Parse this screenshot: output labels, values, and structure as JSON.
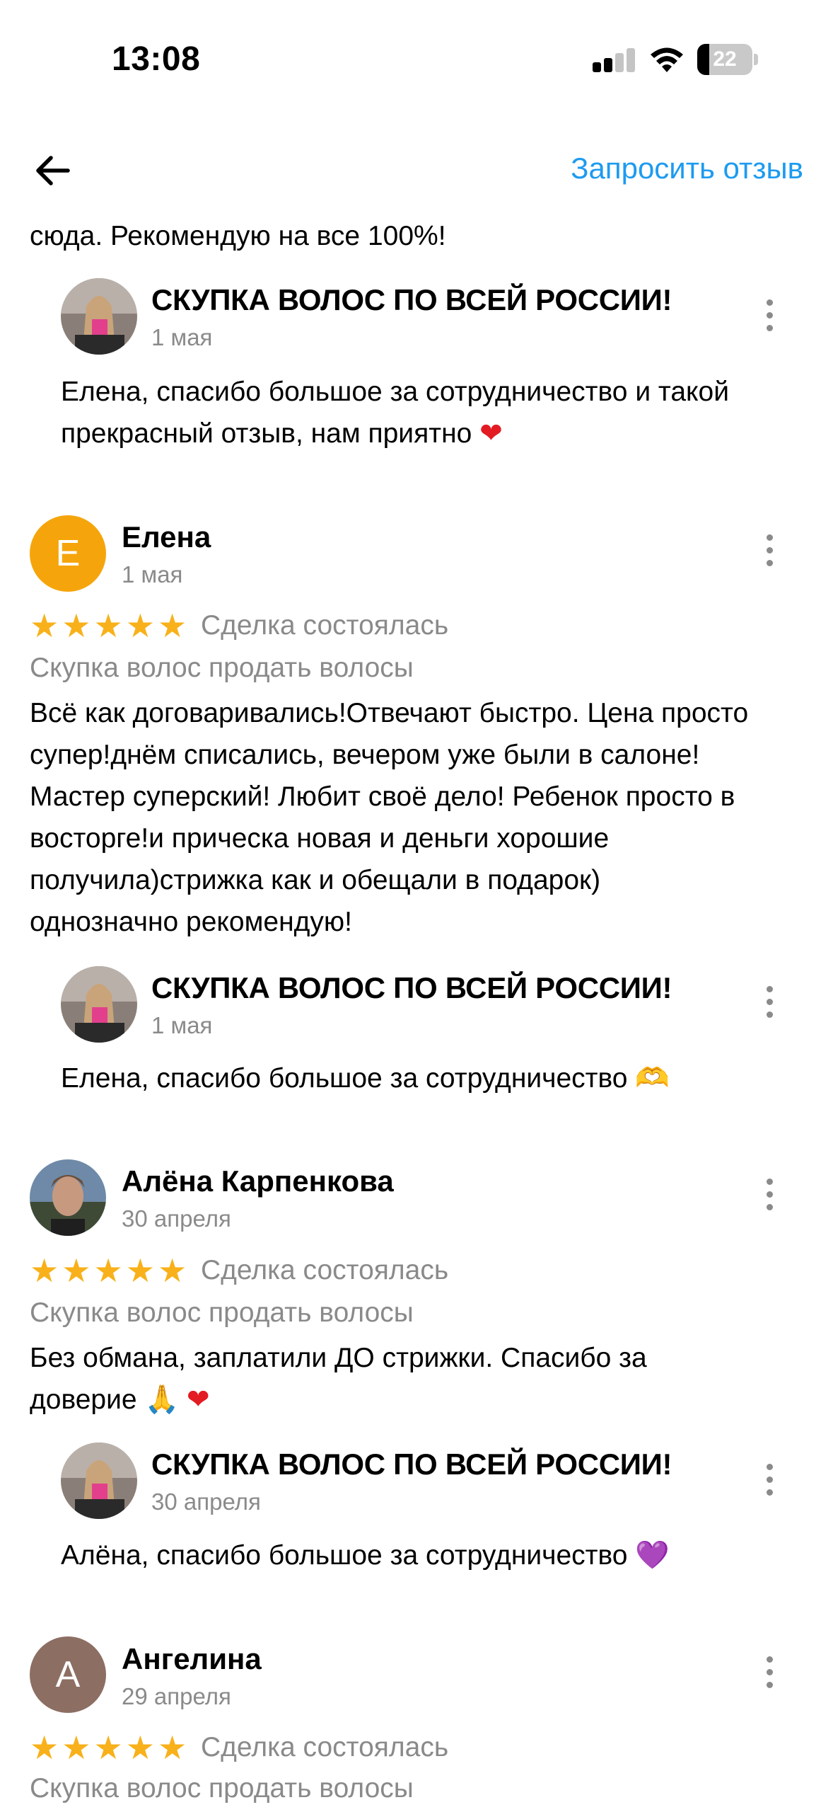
{
  "status_bar": {
    "time": "13:08",
    "battery": "22",
    "battery_level": 0.22
  },
  "header": {
    "request_review": "Запросить отзыв"
  },
  "top_text": "сюда. Рекомендую на все 100%!",
  "reply_author": "СКУПКА ВОЛОС ПО ВСЕЙ РОССИИ!",
  "reply1": {
    "date": "1 мая",
    "line1": "Елена, спасибо большое за сотрудничество и такой",
    "line2": "прекрасный отзыв, нам приятно",
    "emoji": "❤"
  },
  "reviews": [
    {
      "avatar_letter": "Е",
      "avatar_color": "#f5a50b",
      "name": "Елена",
      "date": "1 мая",
      "rating": 5,
      "deal": "Сделка состоялась",
      "service": "Скупка волос продать волосы",
      "lines": [
        "Всё как договаривались!Отвечают быстро. Цена просто",
        "супер!днём списались, вечером уже были в салоне!",
        "Мастер суперский! Любит своё дело! Ребенок просто в",
        "восторге!и прическа новая и деньги хорошие",
        "получила)стрижка как и обещали в подарок)",
        "однозначно рекомендую!"
      ],
      "reply": {
        "date": "1 мая",
        "text": "Елена, спасибо большое за сотрудничество",
        "emoji": "🫶"
      }
    },
    {
      "name": "Алёна Карпенкова",
      "date": "30 апреля",
      "rating": 5,
      "deal": "Сделка состоялась",
      "service": "Скупка волос продать волосы",
      "lines": [
        "Без обмана, заплатили ДО стрижки. Спасибо за",
        "доверие"
      ],
      "emoji": "🙏 ❤",
      "reply": {
        "date": "30 апреля",
        "text": "Алёна, спасибо большое за сотрудничество",
        "emoji": "💜"
      }
    },
    {
      "avatar_letter": "А",
      "avatar_color": "#8d6e63",
      "name": "Ангелина",
      "date": "29 апреля",
      "rating": 5,
      "deal": "Сделка состоялась",
      "service": "Скупка волос продать волосы"
    }
  ],
  "colors": {
    "accent": "#1d9bf0",
    "star": "#f8b11a",
    "muted": "#8a8a8a"
  }
}
